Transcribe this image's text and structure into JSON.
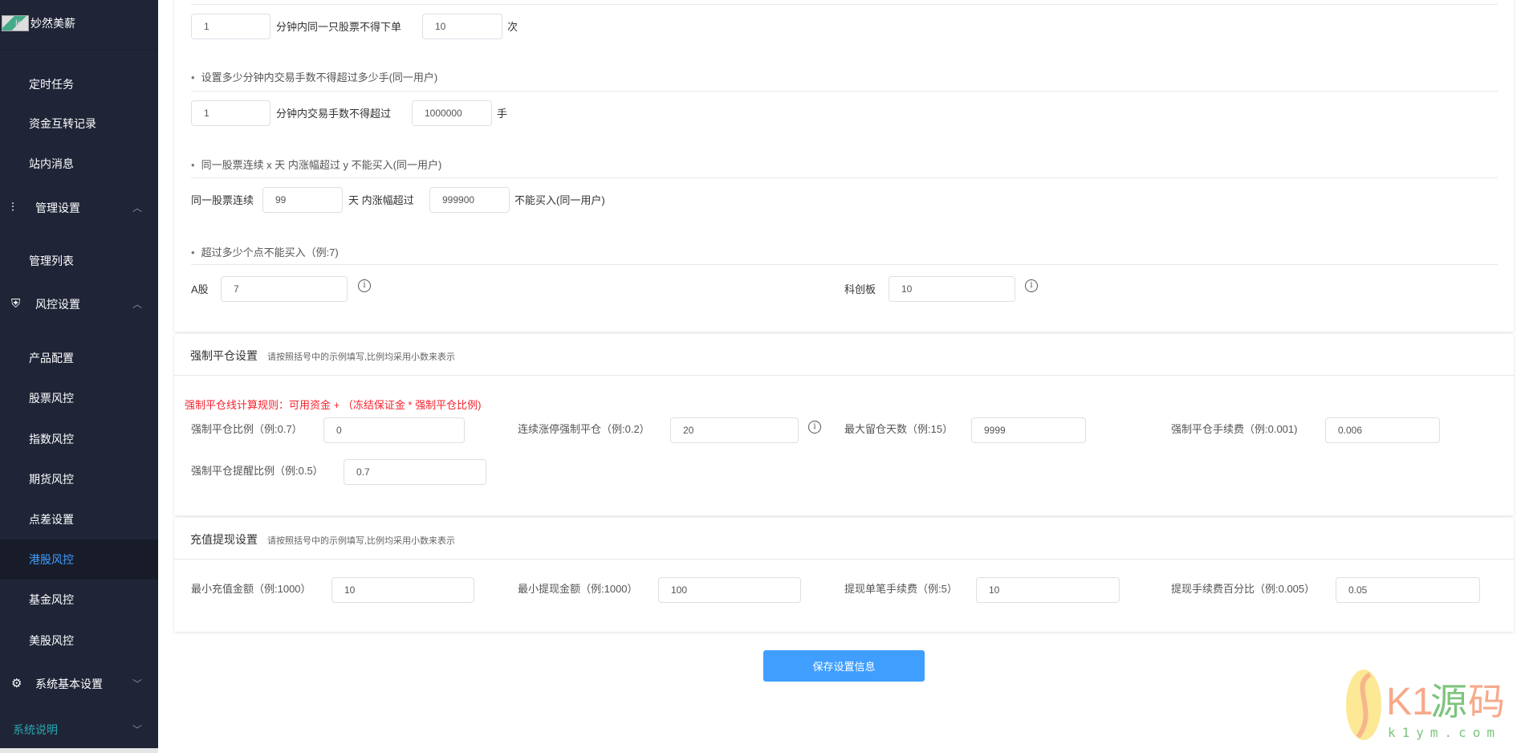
{
  "sidebar": {
    "brand": "妙然美薪",
    "logo_alt": "lo",
    "items": [
      "定时任务",
      "资金互转记录",
      "站内消息"
    ],
    "group_manage": "管理设置",
    "manage_items": [
      "管理列表"
    ],
    "group_risk": "风控设置",
    "risk_items": [
      "产品配置",
      "股票风控",
      "指数风控",
      "期货风控",
      "点差设置",
      "港股风控",
      "基金风控",
      "美股风控"
    ],
    "group_system": "系统基本设置",
    "group_doc": "系统说明",
    "active": "港股风控"
  },
  "section1": {
    "row1": {
      "minutes": "1",
      "text": "分钟内同一只股票不得下单",
      "count": "10",
      "unit": "次"
    },
    "bullet2": "设置多少分钟内交易手数不得超过多少手(同一用户)",
    "row2": {
      "minutes": "1",
      "text": "分钟内交易手数不得超过",
      "lots": "1000000",
      "unit": "手"
    },
    "bullet3": "同一股票连续 x 天 内涨幅超过 y 不能买入(同一用户)",
    "row3": {
      "prefix": "同一股票连续",
      "days": "99",
      "mid": "天 内涨幅超过",
      "pct": "999900",
      "suffix": "不能买入(同一用户)"
    },
    "bullet4": "超过多少个点不能买入（例:7)",
    "row4": {
      "a_label": "A股",
      "a_value": "7",
      "kc_label": "科创板",
      "kc_value": "10"
    }
  },
  "force": {
    "title": "强制平仓设置",
    "subtitle": "请按照括号中的示例填写,比例均采用小数来表示",
    "rule": "强制平仓线计算规则：可用资金 + （冻结保证金 * 强制平仓比例)",
    "fields": [
      {
        "label": "强制平仓比例（例:0.7）",
        "value": "0"
      },
      {
        "label": "连续涨停强制平仓（例:0.2）",
        "value": "20"
      },
      {
        "label": "最大留仓天数（例:15）",
        "value": "9999"
      },
      {
        "label": "强制平仓手续费（例:0.001)",
        "value": "0.006"
      },
      {
        "label": "强制平仓提醒比例（例:0.5）",
        "value": "0.7"
      }
    ]
  },
  "recharge": {
    "title": "充值提现设置",
    "subtitle": "请按照括号中的示例填写,比例均采用小数来表示",
    "fields": [
      {
        "label": "最小充值金额（例:1000）",
        "value": "10"
      },
      {
        "label": "最小提现金额（例:1000）",
        "value": "100"
      },
      {
        "label": "提现单笔手续费（例:5）",
        "value": "10"
      },
      {
        "label": "提现手续费百分比（例:0.005）",
        "value": "0.05"
      }
    ]
  },
  "save_label": "保存设置信息",
  "watermark": {
    "brand": "K1源码",
    "url": "k1ym.com"
  },
  "colors": {
    "sidebar": "#1f2537",
    "active": "#409eff",
    "danger": "#f5222d",
    "teal": "#29a7b0"
  }
}
